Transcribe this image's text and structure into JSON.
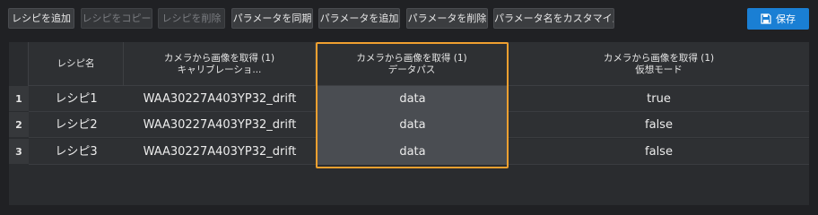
{
  "toolbar": {
    "buttons": [
      {
        "label": "レシピを追加",
        "enabled": true
      },
      {
        "label": "レシピをコピー",
        "enabled": false
      },
      {
        "label": "レシピを削除",
        "enabled": false
      },
      {
        "label": "パラメータを同期",
        "enabled": true
      },
      {
        "label": "パラメータを追加",
        "enabled": true
      },
      {
        "label": "パラメータを削除",
        "enabled": true
      },
      {
        "label": "パラメータ名をカスタマイズ",
        "enabled": true
      }
    ],
    "save_label": "保存",
    "accent_color": "#1a7fd4"
  },
  "table": {
    "selected_color": "#f0a030",
    "headers": [
      {
        "line1": "レシピ名",
        "line2": ""
      },
      {
        "line1": "カメラから画像を取得 (1)",
        "line2": "キャリブレーショ..."
      },
      {
        "line1": "カメラから画像を取得 (1)",
        "line2": "データパス"
      },
      {
        "line1": "カメラから画像を取得 (1)",
        "line2": "仮想モード"
      }
    ],
    "rows": [
      {
        "num": "1",
        "name": "レシピ1",
        "calibration": "WAA30227A403YP32_drift",
        "data_path": "data",
        "virtual_mode": "true"
      },
      {
        "num": "2",
        "name": "レシピ2",
        "calibration": "WAA30227A403YP32_drift",
        "data_path": "data",
        "virtual_mode": "false"
      },
      {
        "num": "3",
        "name": "レシピ3",
        "calibration": "WAA30227A403YP32_drift",
        "data_path": "data",
        "virtual_mode": "false"
      }
    ]
  }
}
